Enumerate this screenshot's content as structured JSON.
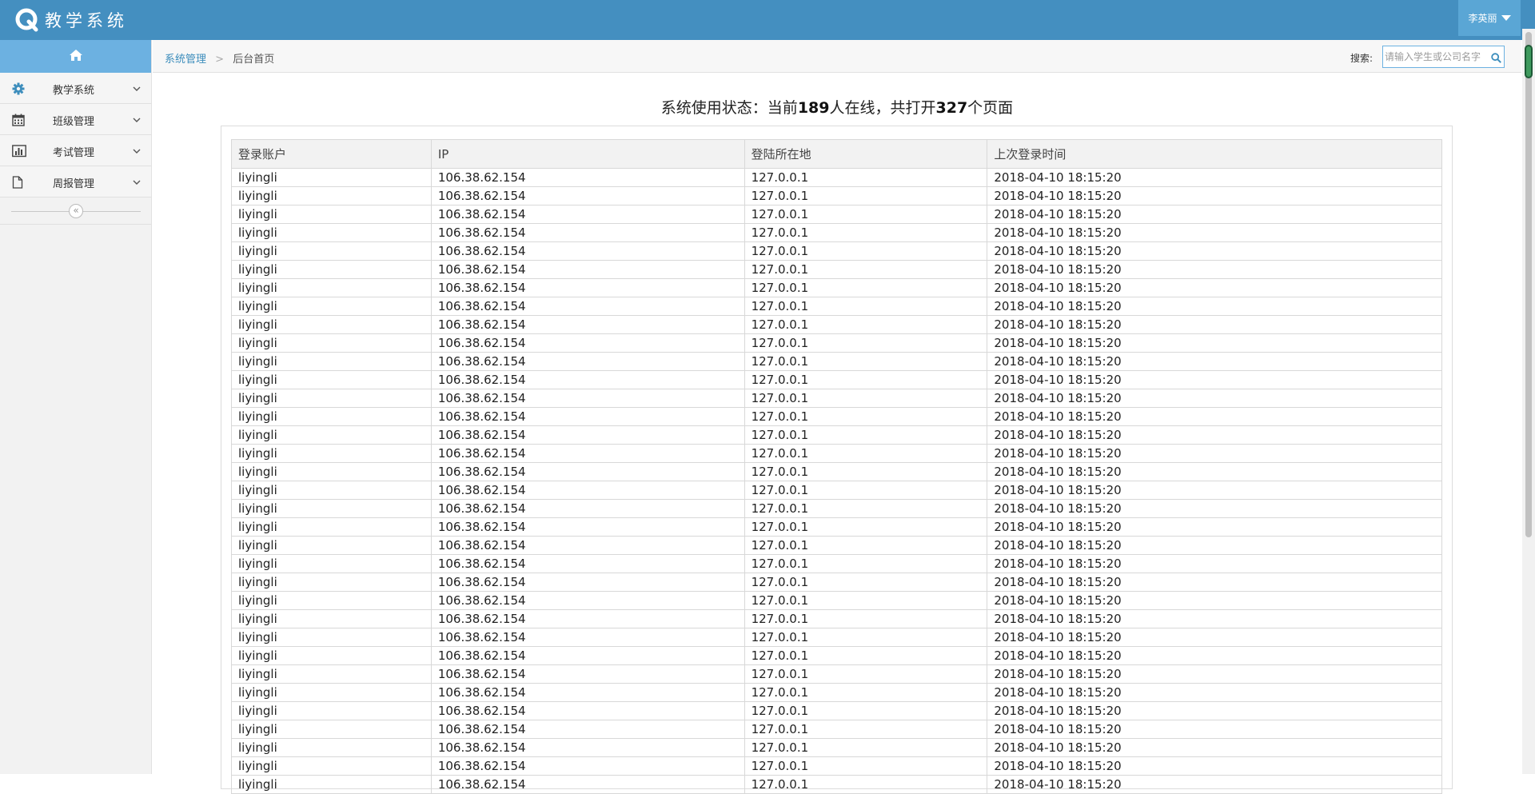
{
  "header": {
    "app_title": "教学系统",
    "user_name": "李英丽",
    "colors": {
      "navbar": "#448fc0",
      "user_menu": "#5aa6d5",
      "sidebar_home": "#6cb1e1"
    }
  },
  "sidebar": {
    "home_icon": "home-icon",
    "items": [
      {
        "label": "教学系统",
        "icon": "gear-icon"
      },
      {
        "label": "班级管理",
        "icon": "calendar-icon"
      },
      {
        "label": "考试管理",
        "icon": "bar-chart-icon"
      },
      {
        "label": "周报管理",
        "icon": "file-icon"
      }
    ],
    "collapse_symbol": "«"
  },
  "breadcrumb": {
    "parent": "系统管理",
    "separator": ">",
    "current": "后台首页"
  },
  "search": {
    "label": "搜索:",
    "placeholder": "请输入学生或公司名字"
  },
  "status": {
    "prefix": "系统使用状态：当前",
    "online_count": "189",
    "middle": "人在线，共打开",
    "page_count": "327",
    "suffix": "个页面"
  },
  "table": {
    "columns": [
      "登录账户",
      "IP",
      "登陆所在地",
      "上次登录时间"
    ],
    "rows": [
      [
        "liyingli",
        "106.38.62.154",
        "127.0.0.1",
        "2018-04-10 18:15:20"
      ],
      [
        "liyingli",
        "106.38.62.154",
        "127.0.0.1",
        "2018-04-10 18:15:20"
      ],
      [
        "liyingli",
        "106.38.62.154",
        "127.0.0.1",
        "2018-04-10 18:15:20"
      ],
      [
        "liyingli",
        "106.38.62.154",
        "127.0.0.1",
        "2018-04-10 18:15:20"
      ],
      [
        "liyingli",
        "106.38.62.154",
        "127.0.0.1",
        "2018-04-10 18:15:20"
      ],
      [
        "liyingli",
        "106.38.62.154",
        "127.0.0.1",
        "2018-04-10 18:15:20"
      ],
      [
        "liyingli",
        "106.38.62.154",
        "127.0.0.1",
        "2018-04-10 18:15:20"
      ],
      [
        "liyingli",
        "106.38.62.154",
        "127.0.0.1",
        "2018-04-10 18:15:20"
      ],
      [
        "liyingli",
        "106.38.62.154",
        "127.0.0.1",
        "2018-04-10 18:15:20"
      ],
      [
        "liyingli",
        "106.38.62.154",
        "127.0.0.1",
        "2018-04-10 18:15:20"
      ],
      [
        "liyingli",
        "106.38.62.154",
        "127.0.0.1",
        "2018-04-10 18:15:20"
      ],
      [
        "liyingli",
        "106.38.62.154",
        "127.0.0.1",
        "2018-04-10 18:15:20"
      ],
      [
        "liyingli",
        "106.38.62.154",
        "127.0.0.1",
        "2018-04-10 18:15:20"
      ],
      [
        "liyingli",
        "106.38.62.154",
        "127.0.0.1",
        "2018-04-10 18:15:20"
      ],
      [
        "liyingli",
        "106.38.62.154",
        "127.0.0.1",
        "2018-04-10 18:15:20"
      ],
      [
        "liyingli",
        "106.38.62.154",
        "127.0.0.1",
        "2018-04-10 18:15:20"
      ],
      [
        "liyingli",
        "106.38.62.154",
        "127.0.0.1",
        "2018-04-10 18:15:20"
      ],
      [
        "liyingli",
        "106.38.62.154",
        "127.0.0.1",
        "2018-04-10 18:15:20"
      ],
      [
        "liyingli",
        "106.38.62.154",
        "127.0.0.1",
        "2018-04-10 18:15:20"
      ],
      [
        "liyingli",
        "106.38.62.154",
        "127.0.0.1",
        "2018-04-10 18:15:20"
      ],
      [
        "liyingli",
        "106.38.62.154",
        "127.0.0.1",
        "2018-04-10 18:15:20"
      ],
      [
        "liyingli",
        "106.38.62.154",
        "127.0.0.1",
        "2018-04-10 18:15:20"
      ],
      [
        "liyingli",
        "106.38.62.154",
        "127.0.0.1",
        "2018-04-10 18:15:20"
      ],
      [
        "liyingli",
        "106.38.62.154",
        "127.0.0.1",
        "2018-04-10 18:15:20"
      ],
      [
        "liyingli",
        "106.38.62.154",
        "127.0.0.1",
        "2018-04-10 18:15:20"
      ],
      [
        "liyingli",
        "106.38.62.154",
        "127.0.0.1",
        "2018-04-10 18:15:20"
      ],
      [
        "liyingli",
        "106.38.62.154",
        "127.0.0.1",
        "2018-04-10 18:15:20"
      ],
      [
        "liyingli",
        "106.38.62.154",
        "127.0.0.1",
        "2018-04-10 18:15:20"
      ],
      [
        "liyingli",
        "106.38.62.154",
        "127.0.0.1",
        "2018-04-10 18:15:20"
      ],
      [
        "liyingli",
        "106.38.62.154",
        "127.0.0.1",
        "2018-04-10 18:15:20"
      ],
      [
        "liyingli",
        "106.38.62.154",
        "127.0.0.1",
        "2018-04-10 18:15:20"
      ],
      [
        "liyingli",
        "106.38.62.154",
        "127.0.0.1",
        "2018-04-10 18:15:20"
      ],
      [
        "liyingli",
        "106.38.62.154",
        "127.0.0.1",
        "2018-04-10 18:15:20"
      ],
      [
        "liyingli",
        "106.38.62.154",
        "127.0.0.1",
        "2018-04-10 18:15:20"
      ]
    ]
  }
}
